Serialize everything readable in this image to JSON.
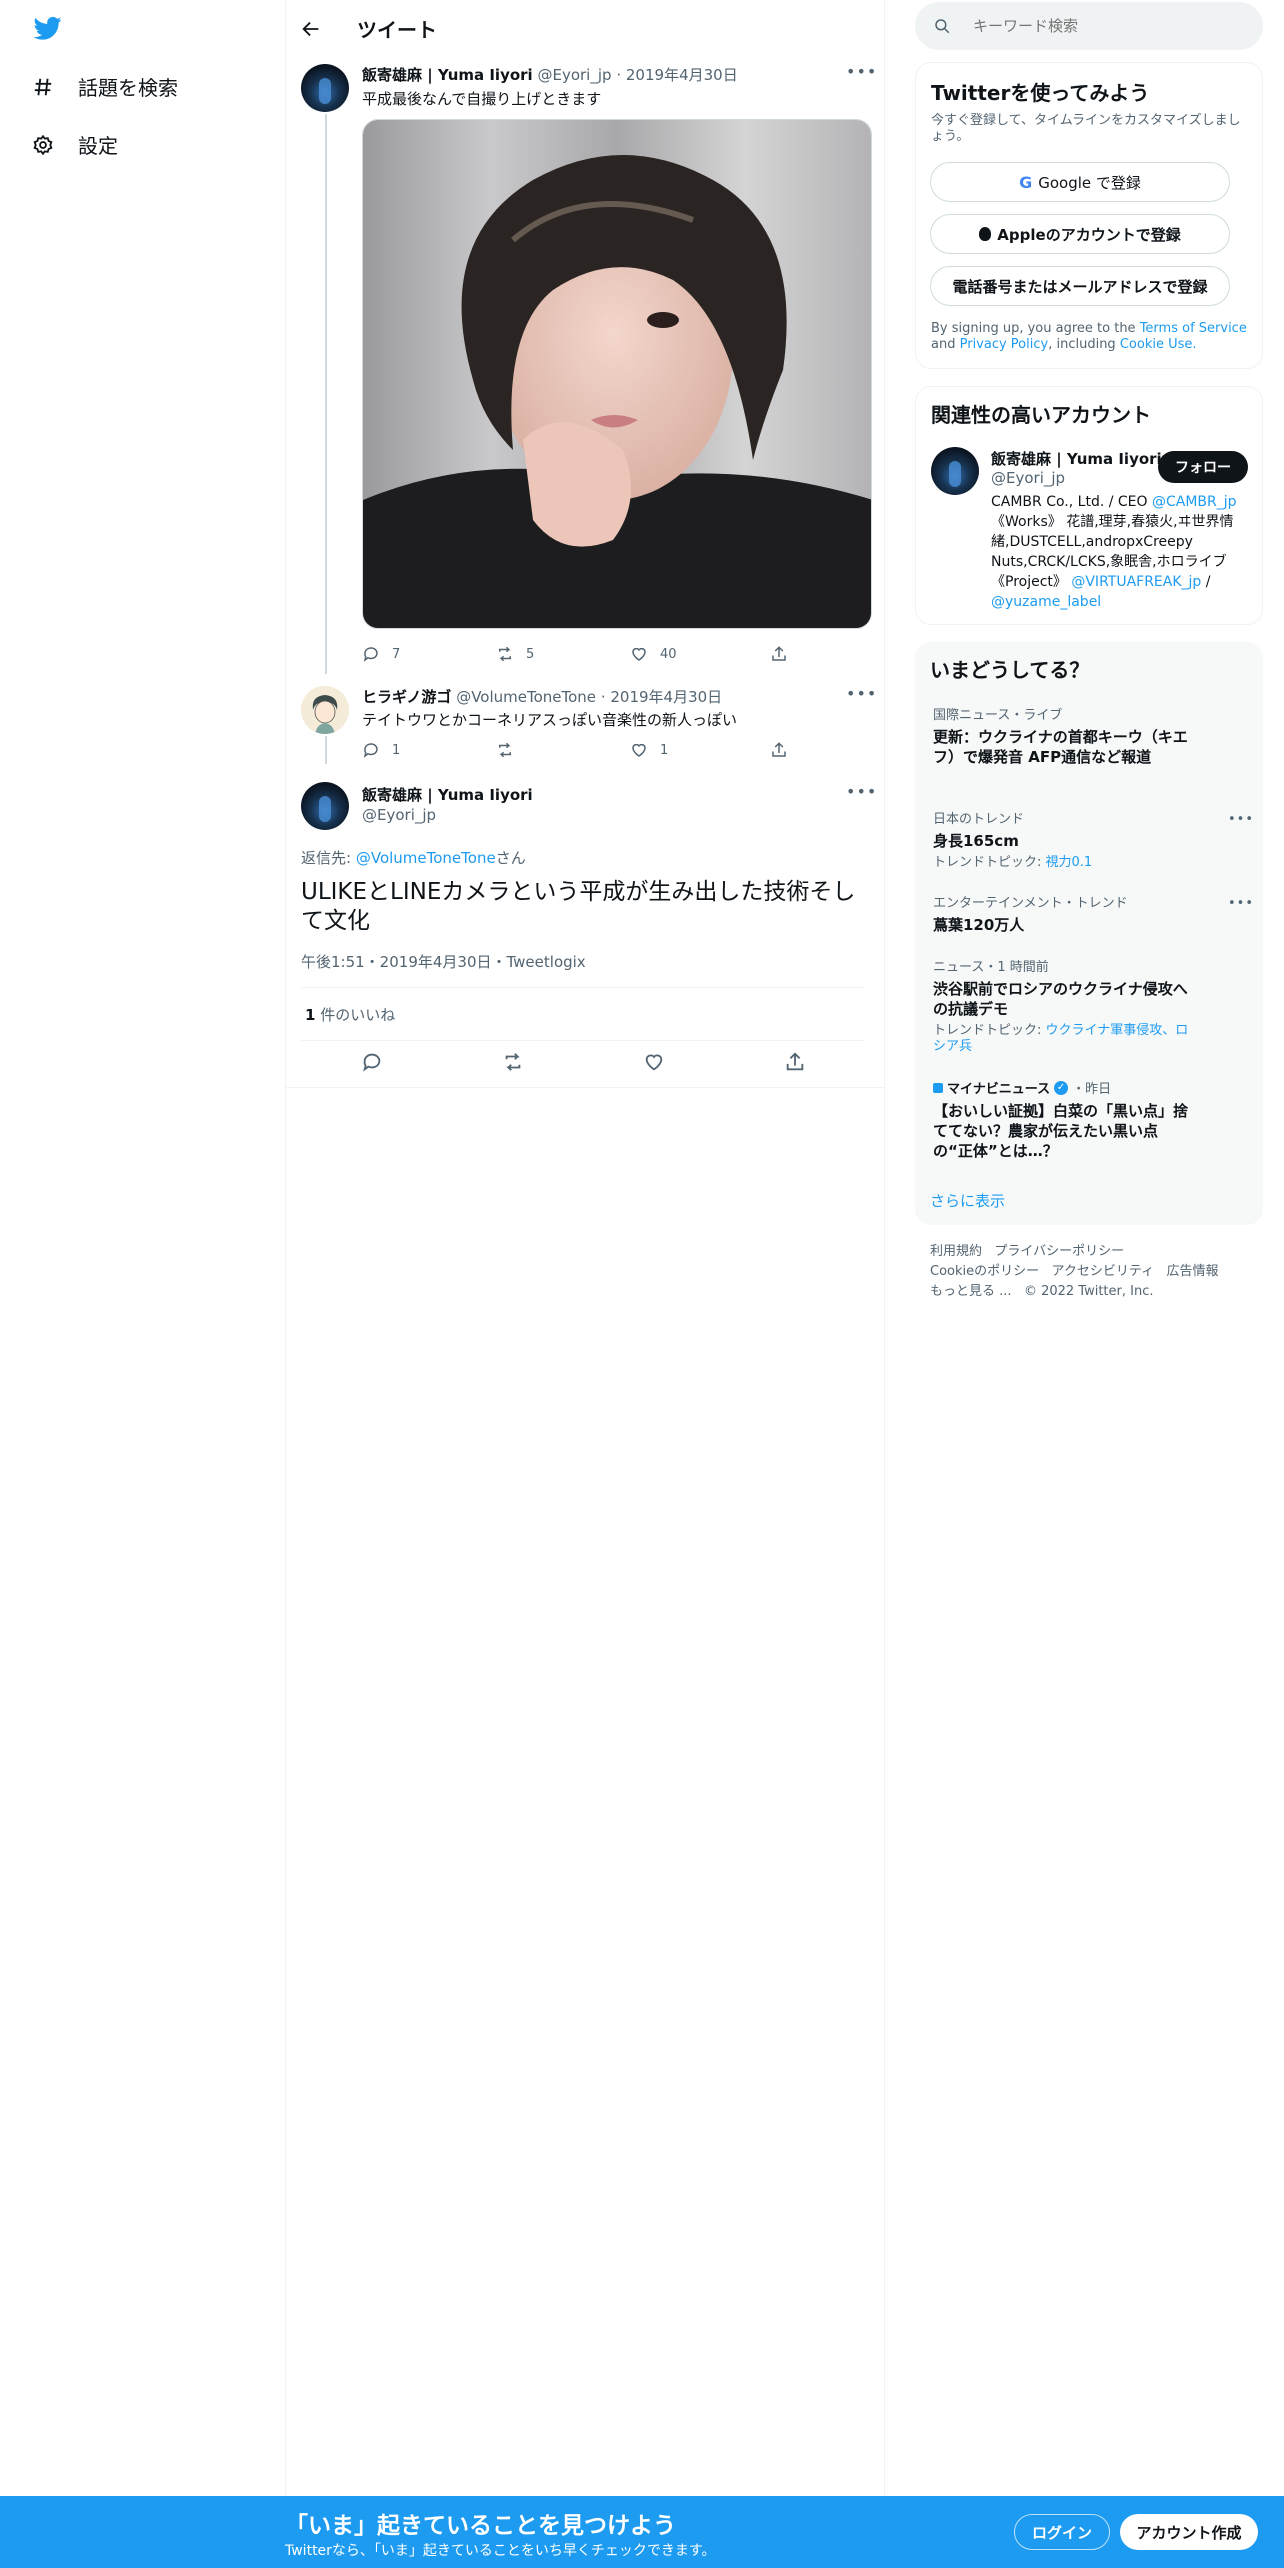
{
  "sidebar": {
    "items": [
      {
        "label": "話題を検索",
        "icon": "hash-icon"
      },
      {
        "label": "設定",
        "icon": "gear-icon"
      }
    ]
  },
  "header": {
    "title": "ツイート"
  },
  "tweet1": {
    "name": "飯寄雄麻 | Yuma Iiyori",
    "handle": "@Eyori_jp",
    "time": "2019年4月30日",
    "text": "平成最後なんで自撮り上げときます",
    "replies": "7",
    "retweets": "5",
    "likes": "40"
  },
  "tweet2": {
    "name": "ヒラギノ游ゴ",
    "handle": "@VolumeToneTone",
    "time": "2019年4月30日",
    "text": "テイトウワとかコーネリアスっぽい音楽性の新人っぽい",
    "replies": "1",
    "likes": "1"
  },
  "main": {
    "name": "飯寄雄麻 | Yuma Iiyori",
    "handle": "@Eyori_jp",
    "reply_label": "返信先:",
    "reply_to": "@VolumeToneTone",
    "reply_suffix": "さん",
    "text": "ULIKEとLINEカメラという平成が生み出した技術そして文化",
    "meta": "午後1:51・2019年4月30日・Tweetlogix",
    "likes_count": "1",
    "likes_label": "件のいいね"
  },
  "search": {
    "placeholder": "キーワード検索"
  },
  "signup": {
    "title": "Twitterを使ってみよう",
    "subtitle": "今すぐ登録して、タイムラインをカスタマイズしましょう。",
    "google": "Google で登録",
    "apple": "Appleのアカウントで登録",
    "phone": "電話番号またはメールアドレスで登録",
    "terms_pre": "By signing up, you agree to the",
    "terms": "Terms of Service",
    "and": "and",
    "privacy": "Privacy Policy",
    "including": ", including",
    "cookie": "Cookie Use."
  },
  "related": {
    "title": "関連性の高いアカウント",
    "name": "飯寄雄麻 | Yuma Iiyori",
    "handle": "@Eyori_jp",
    "follow": "フォロー",
    "bio1": "CAMBR Co., Ltd. / CEO ",
    "bio_link1": "@CAMBR_jp",
    "bio2": "《Works》 花譜,理芽,春猿火,ヰ世界情緒,DUSTCELL,andropxCreepy Nuts,CRCK/LCKS,象眠舎,ホロライブ 《Project》 ",
    "bio_link2": "@VIRTUAFREAK_jp",
    "bio_sep": " / ",
    "bio_link3": "@yuzame_label"
  },
  "trends": {
    "title": "いまどうしてる？",
    "items": [
      {
        "cat": "国際ニュース・ライブ",
        "title": "更新：ウクライナの首都キーウ（キエフ）で爆発音 AFP通信など報道",
        "sub": ""
      },
      {
        "cat": "日本のトレンド",
        "title": "身長165cm",
        "sub_label": "トレンドトピック: ",
        "sub_link": "視力0.1"
      },
      {
        "cat": "エンターテインメント・トレンド",
        "title": "蔦葉120万人",
        "sub": ""
      },
      {
        "cat": "ニュース・1 時間前",
        "title": "渋谷駅前でロシアのウクライナ侵攻への抗議デモ",
        "sub_label": "トレンドトピック: ",
        "sub_link": "ウクライナ軍事侵攻、ロシア兵"
      },
      {
        "cat": "マイナビニュース",
        "cat_time": "・昨日",
        "title": "【おいしい証拠】白菜の「黒い点」捨ててない？農家が伝えたい黒い点の“正体”とは…？"
      }
    ],
    "more": "さらに表示"
  },
  "footer": {
    "l1": [
      "利用規約",
      "プライバシーポリシー"
    ],
    "l2": [
      "Cookieのポリシー",
      "アクセシビリティ",
      "広告情報"
    ],
    "l3": [
      "もっと見る ...",
      "© 2022 Twitter, Inc."
    ]
  },
  "banner": {
    "title": "「いま」起きていることを見つけよう",
    "subtitle": "Twitterなら、「いま」起きていることをいち早くチェックできます。",
    "login": "ログイン",
    "signup": "アカウント作成"
  },
  "colors": {
    "accent": "#1d9bf0",
    "banner": "#1d9bf0",
    "text": "#0f1419",
    "muted": "#536471"
  }
}
